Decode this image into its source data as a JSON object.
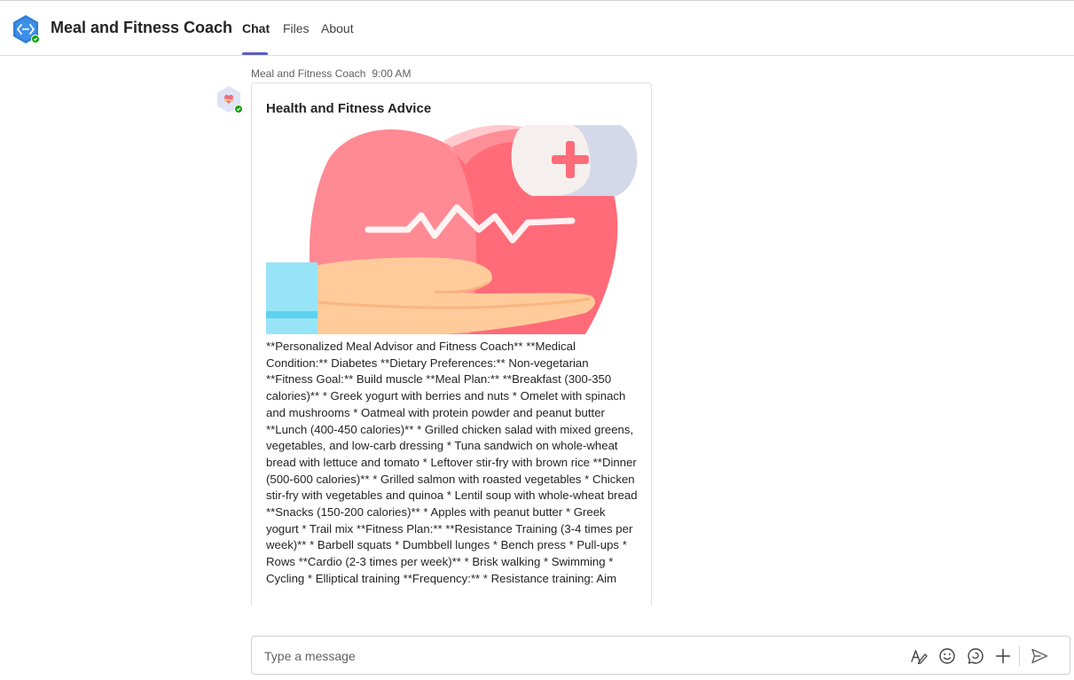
{
  "app": {
    "title": "Meal and Fitness Coach",
    "tabs": [
      {
        "label": "Chat",
        "active": true
      },
      {
        "label": "Files",
        "active": false
      },
      {
        "label": "About",
        "active": false
      }
    ],
    "accent_color": "#5b5fc7",
    "icon": "app-hexagon-icon"
  },
  "message": {
    "sender": "Meal and Fitness Coach",
    "time": "9:00 AM",
    "card": {
      "title": "Health and Fitness Advice",
      "image": "heart-in-hand-illustration",
      "body": "**Personalized Meal Advisor and Fitness Coach** **Medical Condition:** Diabetes **Dietary Preferences:** Non-vegetarian **Fitness Goal:** Build muscle **Meal Plan:** **Breakfast (300-350 calories)** * Greek yogurt with berries and nuts * Omelet with spinach and mushrooms * Oatmeal with protein powder and peanut butter **Lunch (400-450 calories)** * Grilled chicken salad with mixed greens, vegetables, and low-carb dressing * Tuna sandwich on whole-wheat bread with lettuce and tomato * Leftover stir-fry with brown rice **Dinner (500-600 calories)** * Grilled salmon with roasted vegetables * Chicken stir-fry with vegetables and quinoa * Lentil soup with whole-wheat bread **Snacks (150-200 calories)** * Apples with peanut butter * Greek yogurt * Trail mix **Fitness Plan:** **Resistance Training (3-4 times per week)** * Barbell squats * Dumbbell lunges * Bench press * Pull-ups * Rows **Cardio (2-3 times per week)** * Brisk walking * Swimming * Cycling * Elliptical training **Frequency:** * Resistance training: Aim"
    }
  },
  "compose": {
    "placeholder": "Type a message",
    "icons": [
      "format-icon",
      "emoji-icon",
      "sticker-icon",
      "add-icon",
      "send-icon"
    ]
  }
}
